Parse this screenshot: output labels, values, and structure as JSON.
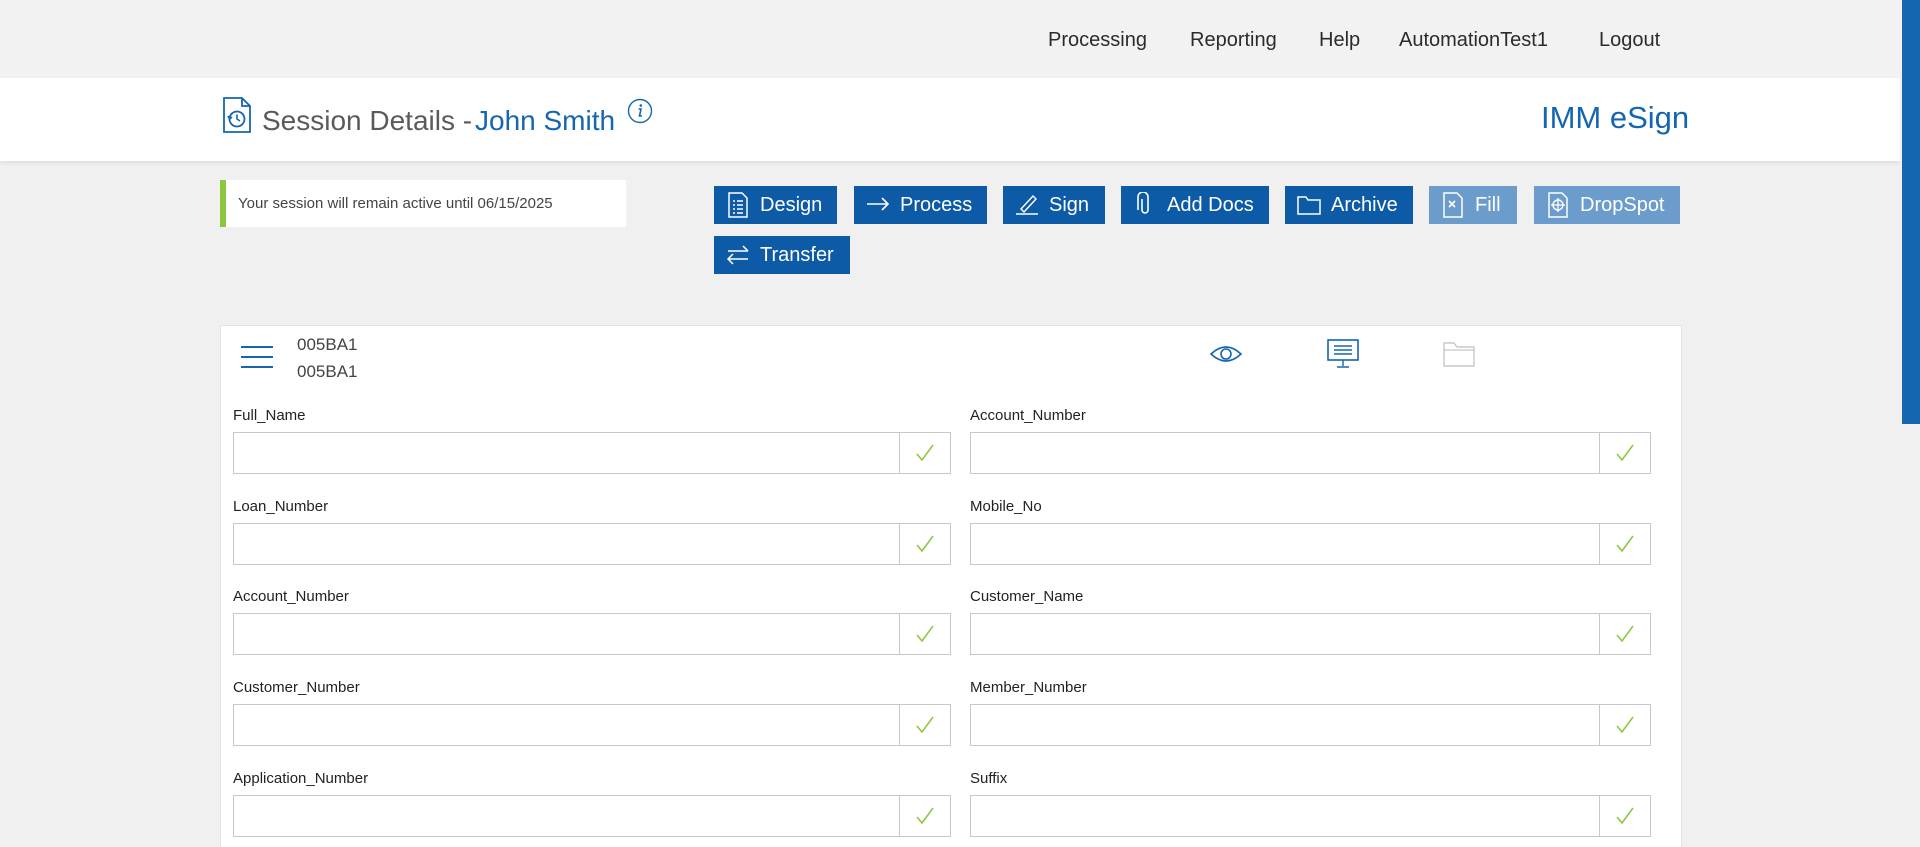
{
  "nav": {
    "items": [
      "Processing",
      "Reporting",
      "Help",
      "AutomationTest1",
      "Logout"
    ]
  },
  "header": {
    "title": "Session Details -",
    "name": "John Smith",
    "brand": "IMM eSign"
  },
  "notice": {
    "text": "Your session will remain active until 06/15/2025",
    "accent": "#8cc63f"
  },
  "actions": [
    {
      "label": "Design",
      "icon": "document-list-icon",
      "style": "primary"
    },
    {
      "label": "Process",
      "icon": "arrow-right-icon",
      "style": "primary"
    },
    {
      "label": "Sign",
      "icon": "pen-icon",
      "style": "primary"
    },
    {
      "label": "Add Docs",
      "icon": "paperclip-icon",
      "style": "primary"
    },
    {
      "label": "Archive",
      "icon": "folder-icon",
      "style": "primary"
    },
    {
      "label": "Fill",
      "icon": "fill-doc-icon",
      "style": "disabled"
    },
    {
      "label": "DropSpot",
      "icon": "dropspot-icon",
      "style": "disabled"
    },
    {
      "label": "Transfer",
      "icon": "swap-arrows-icon",
      "style": "primary"
    }
  ],
  "document": {
    "id_line1": "005BA1",
    "id_line2": "005BA1"
  },
  "fields": [
    {
      "label": "Full_Name",
      "value": ""
    },
    {
      "label": "Account_Number",
      "value": ""
    },
    {
      "label": "Loan_Number",
      "value": ""
    },
    {
      "label": "Mobile_No",
      "value": ""
    },
    {
      "label": "Account_Number",
      "value": ""
    },
    {
      "label": "Customer_Name",
      "value": ""
    },
    {
      "label": "Customer_Number",
      "value": ""
    },
    {
      "label": "Member_Number",
      "value": ""
    },
    {
      "label": "Application_Number",
      "value": ""
    },
    {
      "label": "Suffix",
      "value": ""
    }
  ],
  "colors": {
    "primary": "#0d5aa7",
    "disabled": "#6b9ccb",
    "brand": "#1466b0",
    "check": "#8cc63f"
  }
}
